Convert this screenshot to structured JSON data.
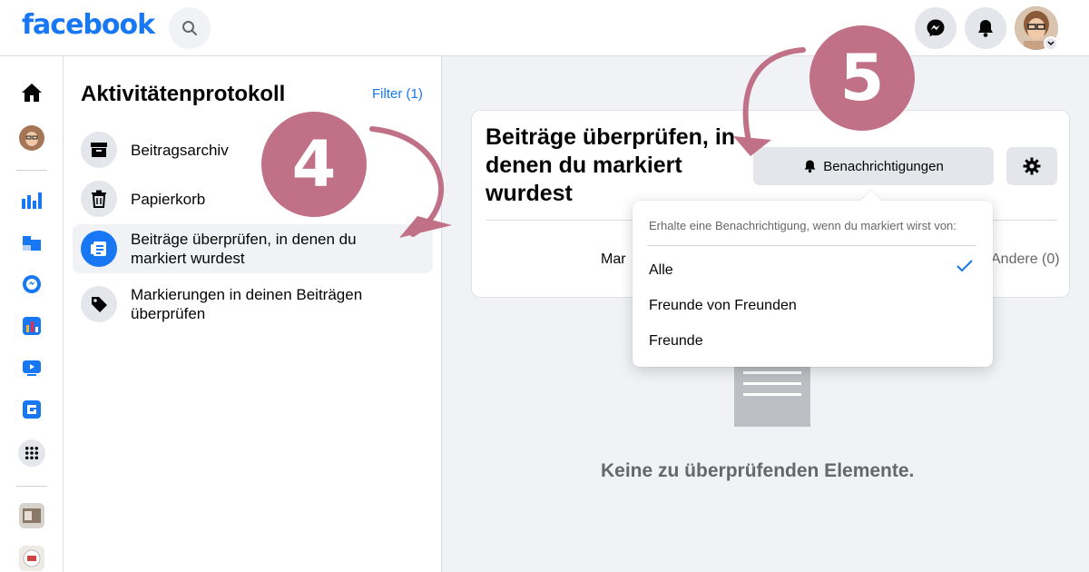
{
  "app": {
    "logo": "facebook"
  },
  "colors": {
    "brand": "#1877f2",
    "annotation": "#c07087",
    "background": "#f0f2f5"
  },
  "topbar": {
    "icons": [
      "search-icon",
      "messenger-icon",
      "bell-icon",
      "avatar",
      "chevron-down-icon"
    ]
  },
  "rail": {
    "icons": [
      "home-icon",
      "profile-avatar",
      "ads-icon",
      "pages-icon",
      "messenger-app-icon",
      "analytics-icon",
      "watch-icon",
      "gaming-icon",
      "menu-grid-icon",
      "group-thumb-1",
      "group-thumb-2"
    ]
  },
  "sidebar": {
    "title": "Aktivitätenprotokoll",
    "filter": "Filter (1)",
    "items": [
      {
        "label": "Beitragsarchiv",
        "icon": "archive-icon"
      },
      {
        "label": "Papierkorb",
        "icon": "trash-icon"
      },
      {
        "label": "Beiträge überprüfen, in denen du markiert wurdest",
        "icon": "tagged-posts-icon",
        "active": true
      },
      {
        "label": "Markierungen in deinen Beiträgen überprüfen",
        "icon": "tag-icon"
      }
    ]
  },
  "card": {
    "title": "Beiträge überprüfen, in denen du markiert wurdest",
    "notifications_button": "Benachrichtigungen",
    "tab_left": "Mar",
    "tab_right": "Andere (0)"
  },
  "dropdown": {
    "hint": "Erhalte eine Benachrichtigung, wenn du markiert wirst von:",
    "options": [
      {
        "label": "Alle",
        "selected": true
      },
      {
        "label": "Freunde von Freunden",
        "selected": false
      },
      {
        "label": "Freunde",
        "selected": false
      }
    ]
  },
  "empty_state": {
    "text": "Keine zu überprüfenden Elemente."
  },
  "annotations": {
    "step_a": "4",
    "step_b": "5"
  }
}
